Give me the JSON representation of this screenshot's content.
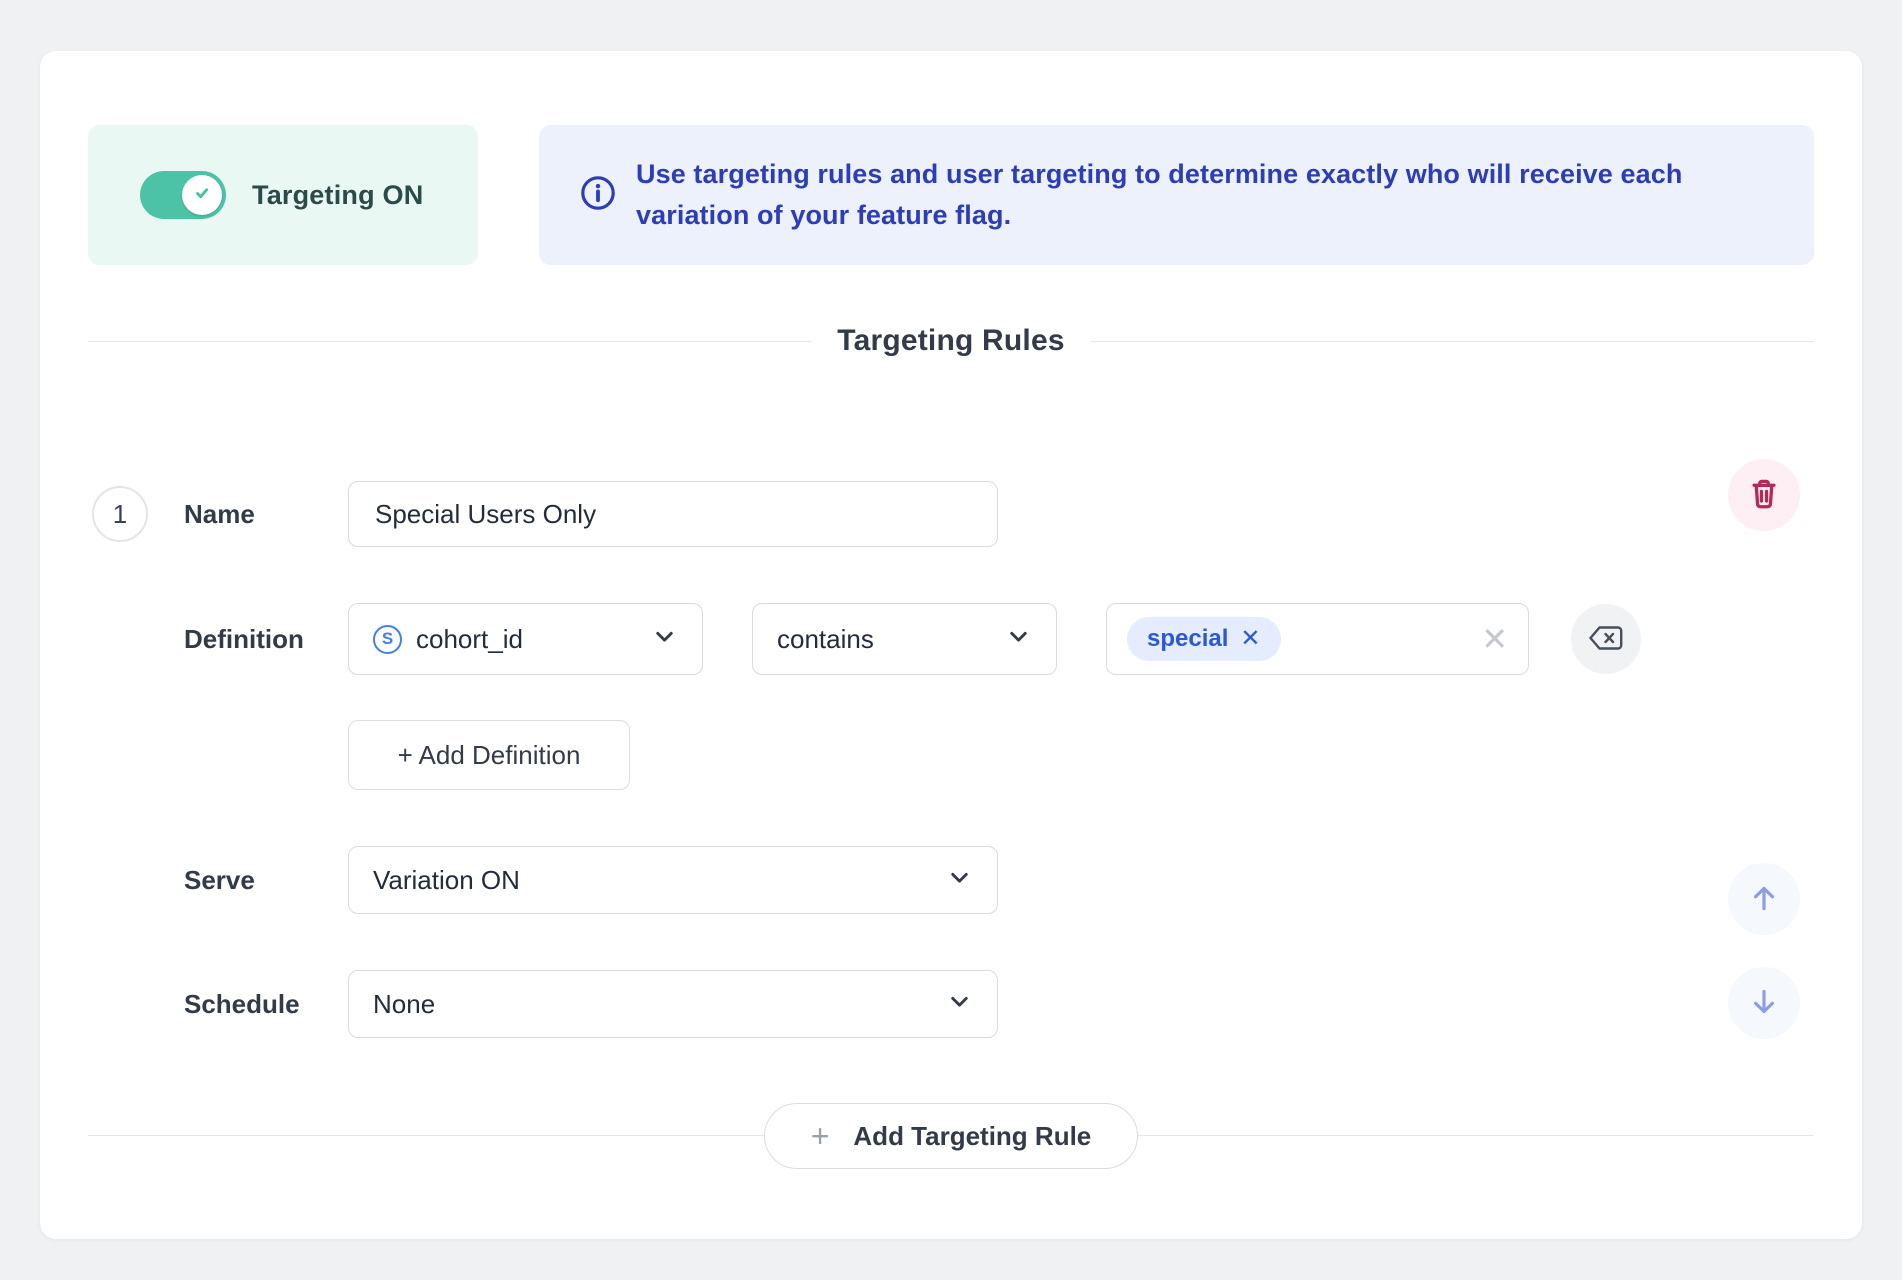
{
  "header": {
    "toggle": {
      "label": "Targeting ON",
      "state": "on",
      "icon": "check-icon"
    },
    "info": {
      "icon": "info-icon",
      "text": "Use targeting rules and user targeting to determine exactly who will receive each variation of your feature flag."
    }
  },
  "section": {
    "title": "Targeting Rules"
  },
  "rule": {
    "number": "1",
    "name": {
      "label": "Name",
      "value": "Special Users Only"
    },
    "definition": {
      "label": "Definition",
      "field": {
        "value": "cohort_id",
        "icon": "segment-s-icon",
        "icon_letter": "S"
      },
      "operator": {
        "value": "contains"
      },
      "values": [
        "special"
      ],
      "chip_remove_icon": "x-icon",
      "clear_icon": "x-icon",
      "backspace_icon": "backspace-icon",
      "add_button": {
        "label": "+ Add Definition"
      }
    },
    "serve": {
      "label": "Serve",
      "value": "Variation ON"
    },
    "schedule": {
      "label": "Schedule",
      "value": "None"
    },
    "actions": {
      "delete_icon": "trash-icon",
      "move_up_icon": "arrow-up-icon",
      "move_down_icon": "arrow-down-icon"
    }
  },
  "footer": {
    "add_rule": {
      "plus": "+",
      "label": "Add Targeting Rule"
    }
  },
  "colors": {
    "page_bg": "#f0f1f3",
    "card_bg": "#ffffff",
    "toggle_teal": "#4cc2a7",
    "toggle_pill_bg": "#e9f8f2",
    "toggle_text": "#2b4a48",
    "info_bg": "#ecf1fc",
    "info_text": "#2c3db6",
    "chip_bg": "#e4ecfd",
    "chip_text": "#2b57d8",
    "danger": "#b42a57",
    "danger_bg": "#fdeff4",
    "arrow": "#8d9ce4",
    "arrow_bg": "#f5f8fd",
    "label_text": "#333b49"
  }
}
